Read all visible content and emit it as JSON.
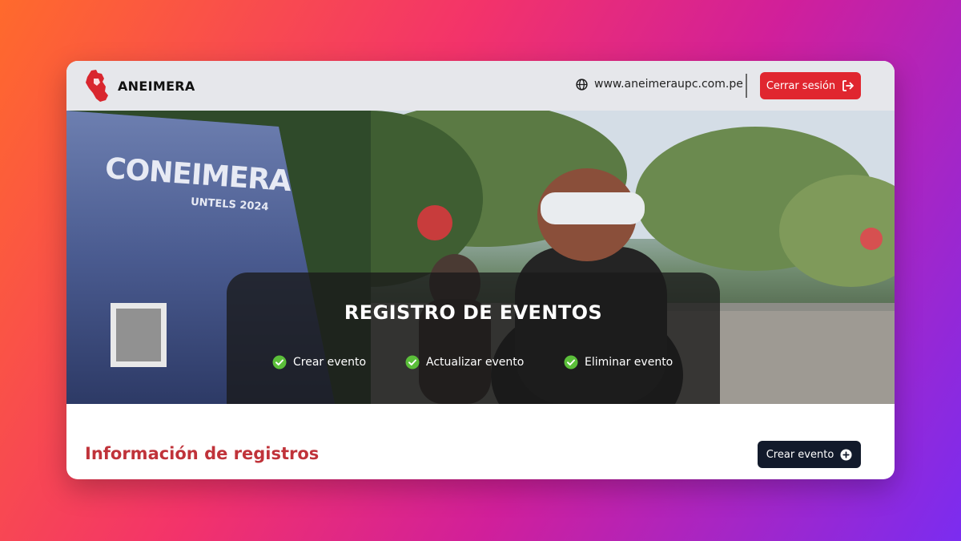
{
  "header": {
    "brand_name": "ANEIMERA",
    "logo_icon": "peru-map-logo",
    "website": "www.aneimeraupc.com.pe",
    "website_icon": "globe-icon",
    "logout_label": "Cerrar sesión",
    "logout_icon": "logout-icon"
  },
  "hero": {
    "title": "REGISTRO DE EVENTOS",
    "banner_text_1": "CONEIMERA",
    "banner_text_2": "UNTELS 2024",
    "features": [
      {
        "label": "Crear evento",
        "icon": "check-circle-icon"
      },
      {
        "label": "Actualizar evento",
        "icon": "check-circle-icon"
      },
      {
        "label": "Eliminar evento",
        "icon": "check-circle-icon"
      }
    ]
  },
  "main": {
    "section_title": "Información de registros",
    "create_button_label": "Crear evento",
    "create_button_icon": "plus-circle-icon"
  },
  "colors": {
    "accent_red": "#e0262f",
    "title_red": "#c0333a",
    "dark_button": "#121a2b",
    "check_green": "#5bbf3a"
  }
}
